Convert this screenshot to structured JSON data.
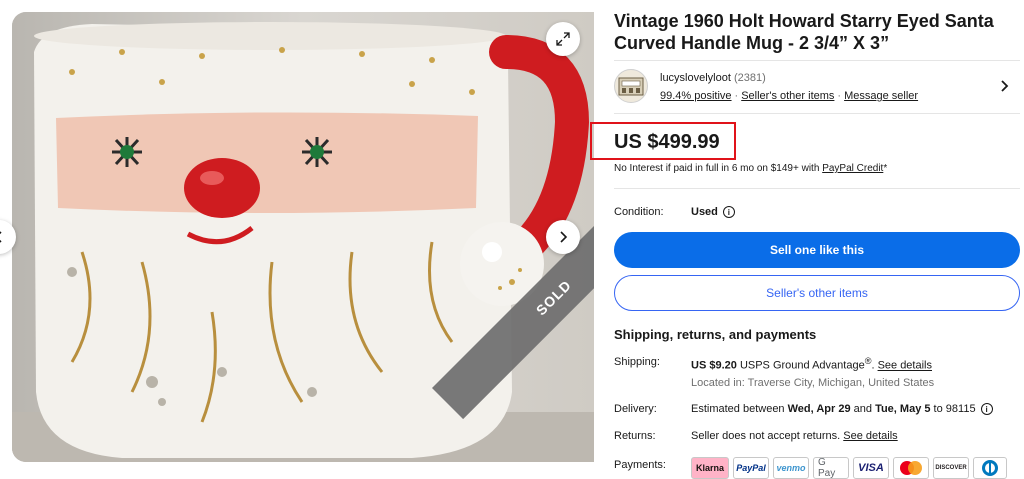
{
  "gallery": {
    "sold_label": "SOLD"
  },
  "listing": {
    "title": "Vintage 1960 Holt Howard Starry Eyed Santa Curved Handle Mug - 2 3/4” X 3”"
  },
  "seller": {
    "name": "lucyslovelyloot",
    "count": "(2381)",
    "positive": "99.4% positive",
    "other_items_link": "Seller's other items",
    "message_link": "Message seller"
  },
  "price": {
    "amount": "US $499.99",
    "financing_text": "No Interest if paid in full in 6 mo on $149+ with ",
    "financing_link": "PayPal Credit",
    "financing_suffix": "*",
    "highlight_color": "#e0131a"
  },
  "condition": {
    "label": "Condition:",
    "value": "Used"
  },
  "actions": {
    "primary_label": "Sell one like this",
    "secondary_label": "Seller's other items",
    "primary_color": "#0a6de8"
  },
  "shipping": {
    "heading": "Shipping, returns, and payments",
    "shipping_label": "Shipping:",
    "shipping_price": "US $9.20",
    "shipping_service": "USPS Ground Advantage",
    "shipping_reg": "®",
    "shipping_details_link": "See details",
    "location": "Located in: Traverse City, Michigan, United States",
    "delivery_label": "Delivery:",
    "delivery_prefix": "Estimated between ",
    "delivery_start": "Wed, Apr 29",
    "delivery_and": " and ",
    "delivery_end": "Tue, May 5",
    "delivery_suffix": " to 98115",
    "returns_label": "Returns:",
    "returns_text": "Seller does not accept returns. ",
    "returns_link": "See details",
    "payments_label": "Payments:"
  },
  "payments": {
    "klarna": "Klarna",
    "paypal": "PayPal",
    "venmo": "venmo",
    "gpay": "G Pay",
    "visa": "VISA",
    "discover": "DISCOVER"
  }
}
